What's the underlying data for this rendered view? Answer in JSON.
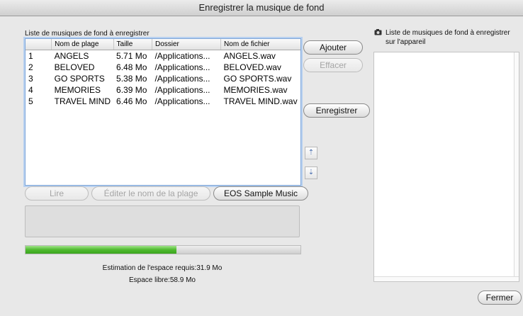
{
  "window": {
    "title": "Enregistrer la musique de fond"
  },
  "left_panel": {
    "list_label": "Liste de musiques de fond à enregistrer",
    "columns": [
      "",
      "Nom de plage",
      "Taille",
      "Dossier",
      "Nom de fichier"
    ],
    "rows": [
      [
        "1",
        "ANGELS",
        "5.71 Mo",
        "/Applications...",
        "ANGELS.wav"
      ],
      [
        "2",
        "BELOVED",
        "6.48 Mo",
        "/Applications...",
        "BELOVED.wav"
      ],
      [
        "3",
        "GO SPORTS",
        "5.38 Mo",
        "/Applications...",
        "GO SPORTS.wav"
      ],
      [
        "4",
        "MEMORIES",
        "6.39 Mo",
        "/Applications...",
        "MEMORIES.wav"
      ],
      [
        "5",
        "TRAVEL MIND",
        "6.46 Mo",
        "/Applications...",
        "TRAVEL MIND.wav"
      ]
    ],
    "buttons": {
      "play": "Lire",
      "rename": "Éditer le nom de la plage",
      "sample": "EOS Sample Music"
    },
    "progress": 0.55,
    "space_required": "Estimation de l'espace requis:31.9 Mo",
    "free_space": "Espace libre:58.9 Mo"
  },
  "middle_buttons": {
    "add": "Ajouter",
    "delete": "Effacer",
    "save": "Enregistrer"
  },
  "right_panel": {
    "label_line1": "Liste de musiques de fond à enregistrer",
    "label_line2": "sur l'appareil",
    "icon": "camera-icon"
  },
  "footer": {
    "close": "Fermer"
  },
  "colors": {
    "progress_green": "#4fba2f",
    "list_focus": "#7fa6d8"
  }
}
